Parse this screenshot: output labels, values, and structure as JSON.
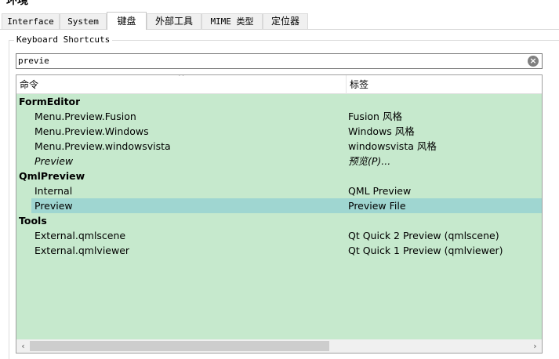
{
  "window": {
    "title": "环境"
  },
  "tabs": [
    {
      "label": "Interface",
      "active": false
    },
    {
      "label": "System",
      "active": false
    },
    {
      "label": "键盘",
      "active": true
    },
    {
      "label": "外部工具",
      "active": false
    },
    {
      "label": "MIME 类型",
      "active": false
    },
    {
      "label": "定位器",
      "active": false
    }
  ],
  "shortcuts": {
    "group_title": "Keyboard Shortcuts",
    "search": {
      "value": "previe",
      "clear_icon": "clear-icon"
    },
    "columns": {
      "command": "命令",
      "label": "标签"
    },
    "rows": [
      {
        "type": "group",
        "command": "FormEditor",
        "label": ""
      },
      {
        "type": "child",
        "command": "Menu.Preview.Fusion",
        "label": "Fusion 风格"
      },
      {
        "type": "child",
        "command": "Menu.Preview.Windows",
        "label": "Windows 风格"
      },
      {
        "type": "child",
        "command": "Menu.Preview.windowsvista",
        "label": "windowsvista 风格"
      },
      {
        "type": "child",
        "command": "Preview",
        "label": "预览(P)...",
        "italic": true
      },
      {
        "type": "group",
        "command": "QmlPreview",
        "label": ""
      },
      {
        "type": "child",
        "command": "Internal",
        "label": "QML Preview"
      },
      {
        "type": "child",
        "command": "Preview",
        "label": "Preview File",
        "selected": true
      },
      {
        "type": "group",
        "command": "Tools",
        "label": ""
      },
      {
        "type": "child",
        "command": "External.qmlscene",
        "label": "Qt Quick 2 Preview (qmlscene)"
      },
      {
        "type": "child",
        "command": "External.qmlviewer",
        "label": "Qt Quick 1 Preview (qmlviewer)"
      }
    ],
    "scrollbar": {
      "left_arrow": "‹",
      "right_arrow": "›",
      "visible_fraction": 0.6
    }
  },
  "colors": {
    "row_background": "#c6e9cd",
    "selected_row": "#9fd6d1"
  }
}
